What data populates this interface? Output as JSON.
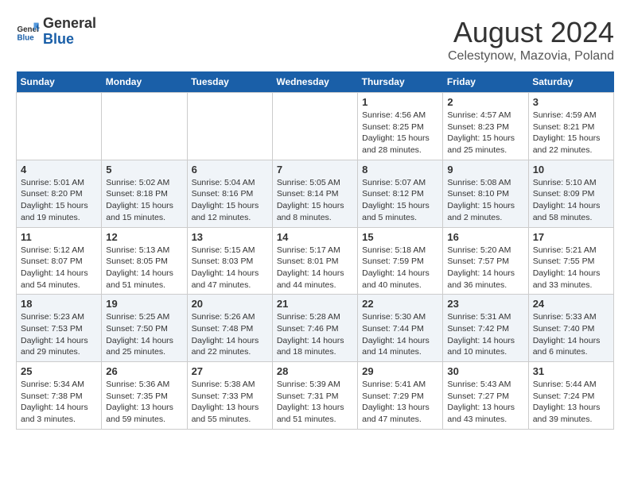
{
  "header": {
    "logo_general": "General",
    "logo_blue": "Blue",
    "month_title": "August 2024",
    "subtitle": "Celestynow, Mazovia, Poland"
  },
  "weekdays": [
    "Sunday",
    "Monday",
    "Tuesday",
    "Wednesday",
    "Thursday",
    "Friday",
    "Saturday"
  ],
  "weeks": [
    [
      {
        "day": "",
        "info": ""
      },
      {
        "day": "",
        "info": ""
      },
      {
        "day": "",
        "info": ""
      },
      {
        "day": "",
        "info": ""
      },
      {
        "day": "1",
        "info": "Sunrise: 4:56 AM\nSunset: 8:25 PM\nDaylight: 15 hours\nand 28 minutes."
      },
      {
        "day": "2",
        "info": "Sunrise: 4:57 AM\nSunset: 8:23 PM\nDaylight: 15 hours\nand 25 minutes."
      },
      {
        "day": "3",
        "info": "Sunrise: 4:59 AM\nSunset: 8:21 PM\nDaylight: 15 hours\nand 22 minutes."
      }
    ],
    [
      {
        "day": "4",
        "info": "Sunrise: 5:01 AM\nSunset: 8:20 PM\nDaylight: 15 hours\nand 19 minutes."
      },
      {
        "day": "5",
        "info": "Sunrise: 5:02 AM\nSunset: 8:18 PM\nDaylight: 15 hours\nand 15 minutes."
      },
      {
        "day": "6",
        "info": "Sunrise: 5:04 AM\nSunset: 8:16 PM\nDaylight: 15 hours\nand 12 minutes."
      },
      {
        "day": "7",
        "info": "Sunrise: 5:05 AM\nSunset: 8:14 PM\nDaylight: 15 hours\nand 8 minutes."
      },
      {
        "day": "8",
        "info": "Sunrise: 5:07 AM\nSunset: 8:12 PM\nDaylight: 15 hours\nand 5 minutes."
      },
      {
        "day": "9",
        "info": "Sunrise: 5:08 AM\nSunset: 8:10 PM\nDaylight: 15 hours\nand 2 minutes."
      },
      {
        "day": "10",
        "info": "Sunrise: 5:10 AM\nSunset: 8:09 PM\nDaylight: 14 hours\nand 58 minutes."
      }
    ],
    [
      {
        "day": "11",
        "info": "Sunrise: 5:12 AM\nSunset: 8:07 PM\nDaylight: 14 hours\nand 54 minutes."
      },
      {
        "day": "12",
        "info": "Sunrise: 5:13 AM\nSunset: 8:05 PM\nDaylight: 14 hours\nand 51 minutes."
      },
      {
        "day": "13",
        "info": "Sunrise: 5:15 AM\nSunset: 8:03 PM\nDaylight: 14 hours\nand 47 minutes."
      },
      {
        "day": "14",
        "info": "Sunrise: 5:17 AM\nSunset: 8:01 PM\nDaylight: 14 hours\nand 44 minutes."
      },
      {
        "day": "15",
        "info": "Sunrise: 5:18 AM\nSunset: 7:59 PM\nDaylight: 14 hours\nand 40 minutes."
      },
      {
        "day": "16",
        "info": "Sunrise: 5:20 AM\nSunset: 7:57 PM\nDaylight: 14 hours\nand 36 minutes."
      },
      {
        "day": "17",
        "info": "Sunrise: 5:21 AM\nSunset: 7:55 PM\nDaylight: 14 hours\nand 33 minutes."
      }
    ],
    [
      {
        "day": "18",
        "info": "Sunrise: 5:23 AM\nSunset: 7:53 PM\nDaylight: 14 hours\nand 29 minutes."
      },
      {
        "day": "19",
        "info": "Sunrise: 5:25 AM\nSunset: 7:50 PM\nDaylight: 14 hours\nand 25 minutes."
      },
      {
        "day": "20",
        "info": "Sunrise: 5:26 AM\nSunset: 7:48 PM\nDaylight: 14 hours\nand 22 minutes."
      },
      {
        "day": "21",
        "info": "Sunrise: 5:28 AM\nSunset: 7:46 PM\nDaylight: 14 hours\nand 18 minutes."
      },
      {
        "day": "22",
        "info": "Sunrise: 5:30 AM\nSunset: 7:44 PM\nDaylight: 14 hours\nand 14 minutes."
      },
      {
        "day": "23",
        "info": "Sunrise: 5:31 AM\nSunset: 7:42 PM\nDaylight: 14 hours\nand 10 minutes."
      },
      {
        "day": "24",
        "info": "Sunrise: 5:33 AM\nSunset: 7:40 PM\nDaylight: 14 hours\nand 6 minutes."
      }
    ],
    [
      {
        "day": "25",
        "info": "Sunrise: 5:34 AM\nSunset: 7:38 PM\nDaylight: 14 hours\nand 3 minutes."
      },
      {
        "day": "26",
        "info": "Sunrise: 5:36 AM\nSunset: 7:35 PM\nDaylight: 13 hours\nand 59 minutes."
      },
      {
        "day": "27",
        "info": "Sunrise: 5:38 AM\nSunset: 7:33 PM\nDaylight: 13 hours\nand 55 minutes."
      },
      {
        "day": "28",
        "info": "Sunrise: 5:39 AM\nSunset: 7:31 PM\nDaylight: 13 hours\nand 51 minutes."
      },
      {
        "day": "29",
        "info": "Sunrise: 5:41 AM\nSunset: 7:29 PM\nDaylight: 13 hours\nand 47 minutes."
      },
      {
        "day": "30",
        "info": "Sunrise: 5:43 AM\nSunset: 7:27 PM\nDaylight: 13 hours\nand 43 minutes."
      },
      {
        "day": "31",
        "info": "Sunrise: 5:44 AM\nSunset: 7:24 PM\nDaylight: 13 hours\nand 39 minutes."
      }
    ]
  ]
}
